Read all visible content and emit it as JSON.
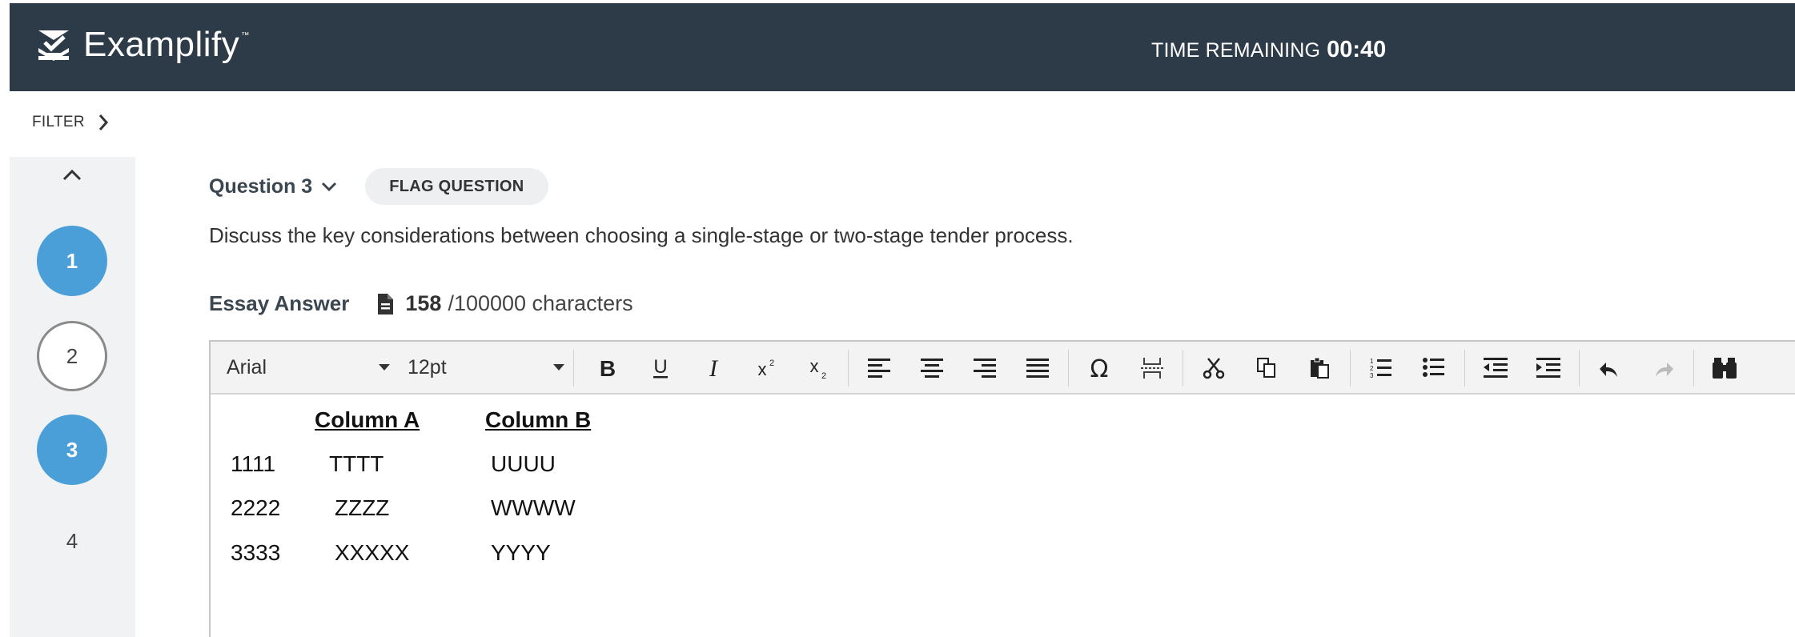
{
  "app": {
    "name": "Examplify",
    "trademark": "™"
  },
  "header": {
    "timer_label": "TIME REMAINING",
    "timer_value": "00:40"
  },
  "filter": {
    "label": "FILTER"
  },
  "questions_nav": [
    {
      "number": "1",
      "state": "answered"
    },
    {
      "number": "2",
      "state": "outlined"
    },
    {
      "number": "3",
      "state": "current-answered"
    },
    {
      "number": "4",
      "state": "plain"
    }
  ],
  "question": {
    "title": "Question 3",
    "flag_label": "FLAG QUESTION",
    "prompt": "Discuss the key considerations between choosing a single-stage or two-stage tender process."
  },
  "essay": {
    "label": "Essay Answer",
    "count": "158",
    "max": "/100000 characters"
  },
  "toolbar": {
    "font_family": "Arial",
    "font_size": "12pt",
    "buttons": [
      "bold-icon",
      "underline-icon",
      "italic-icon",
      "superscript-icon",
      "subscript-icon",
      "align-left-icon",
      "align-center-icon",
      "align-right-icon",
      "justify-icon",
      "special-character-icon",
      "page-break-icon",
      "cut-icon",
      "copy-icon",
      "paste-icon",
      "numbered-list-icon",
      "bulleted-list-icon",
      "outdent-icon",
      "indent-icon",
      "undo-icon",
      "redo-icon",
      "find-icon"
    ]
  },
  "answer": {
    "headers": [
      "Column A",
      "Column B"
    ],
    "rows": [
      [
        "1111",
        "TTTT",
        "UUUU"
      ],
      [
        "2222",
        "ZZZZ",
        "WWWW"
      ],
      [
        "3333",
        "XXXXX",
        "YYYY"
      ]
    ]
  },
  "colors": {
    "topbar": "#2d3b48",
    "accent": "#4a9fd8",
    "sidebar": "#f1f2f3"
  }
}
